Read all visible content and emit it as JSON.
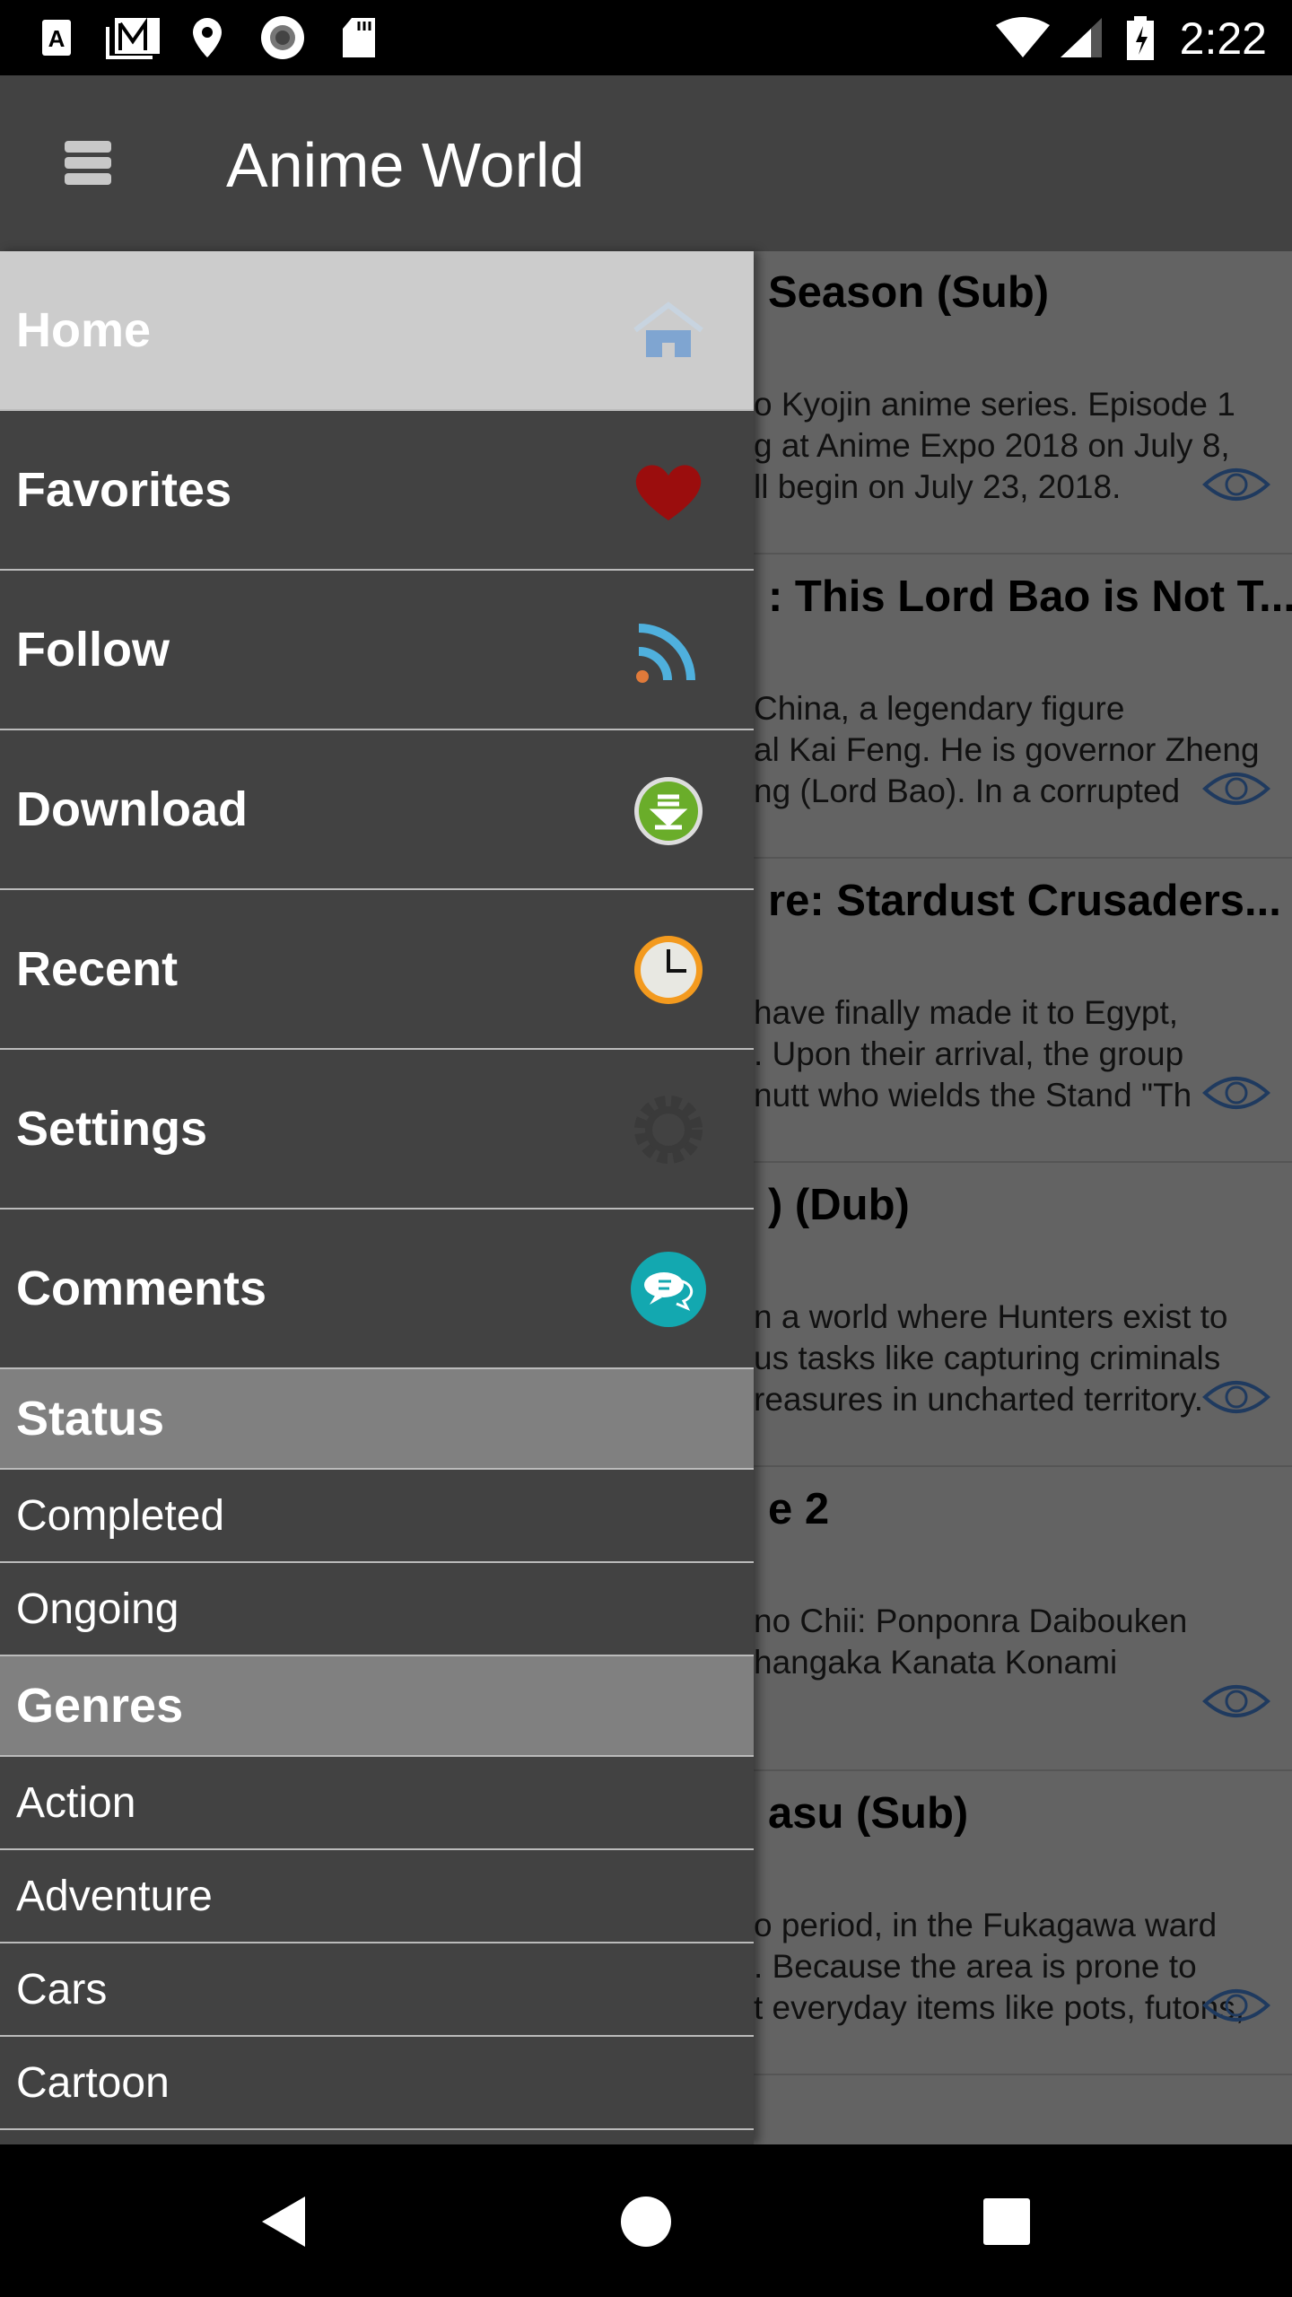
{
  "status_bar": {
    "time": "2:22",
    "icons": [
      "a-notification-icon",
      "gmail-icon",
      "location-icon",
      "record-icon",
      "sd-card-icon",
      "wifi-icon",
      "signal-icon",
      "battery-charging-icon"
    ]
  },
  "toolbar": {
    "title": "Anime World",
    "menu_icon": "hamburger-icon"
  },
  "drawer": {
    "main_items": [
      {
        "label": "Home",
        "icon": "home-icon",
        "active": true
      },
      {
        "label": "Favorites",
        "icon": "heart-icon"
      },
      {
        "label": "Follow",
        "icon": "rss-icon"
      },
      {
        "label": "Download",
        "icon": "download-icon"
      },
      {
        "label": "Recent",
        "icon": "clock-icon"
      },
      {
        "label": "Settings",
        "icon": "gear-icon"
      },
      {
        "label": "Comments",
        "icon": "chat-icon"
      }
    ],
    "status_header": "Status",
    "status_items": [
      "Completed",
      "Ongoing"
    ],
    "genres_header": "Genres",
    "genre_items": [
      "Action",
      "Adventure",
      "Cars",
      "Cartoon"
    ]
  },
  "content": {
    "cards": [
      {
        "title": "Season (Sub)",
        "lines": [
          "o Kyojin anime series. Episode 1",
          "g at Anime Expo 2018 on July 8,",
          "ll begin on July 23, 2018."
        ]
      },
      {
        "title": ": This Lord Bao is Not T...",
        "lines": [
          " China, a legendary figure",
          "al Kai Feng. He is governor Zheng",
          "ng (Lord Bao). In a corrupted"
        ]
      },
      {
        "title": "re: Stardust Crusaders...",
        "lines": [
          " have finally made it to Egypt,",
          ". Upon their arrival, the group",
          "nutt who wields the Stand \"Th"
        ]
      },
      {
        "title": ") (Dub)",
        "lines": [
          "n a world where Hunters exist to",
          "us tasks like capturing criminals",
          "reasures in uncharted territory."
        ]
      },
      {
        "title": "e 2",
        "lines": [
          "no Chii: Ponponra Daibouken",
          "hangaka Kanata Konami",
          ""
        ]
      },
      {
        "title": "asu (Sub)",
        "lines": [
          "o period, in the Fukagawa ward",
          ". Because the area is prone to",
          "t everyday items like pots, futons,"
        ]
      }
    ]
  },
  "colors": {
    "toolbar": "#424242",
    "drawer": "#424242",
    "active_item": "#cccccc",
    "section_header": "#808080",
    "eye": "#1f3a5f"
  }
}
